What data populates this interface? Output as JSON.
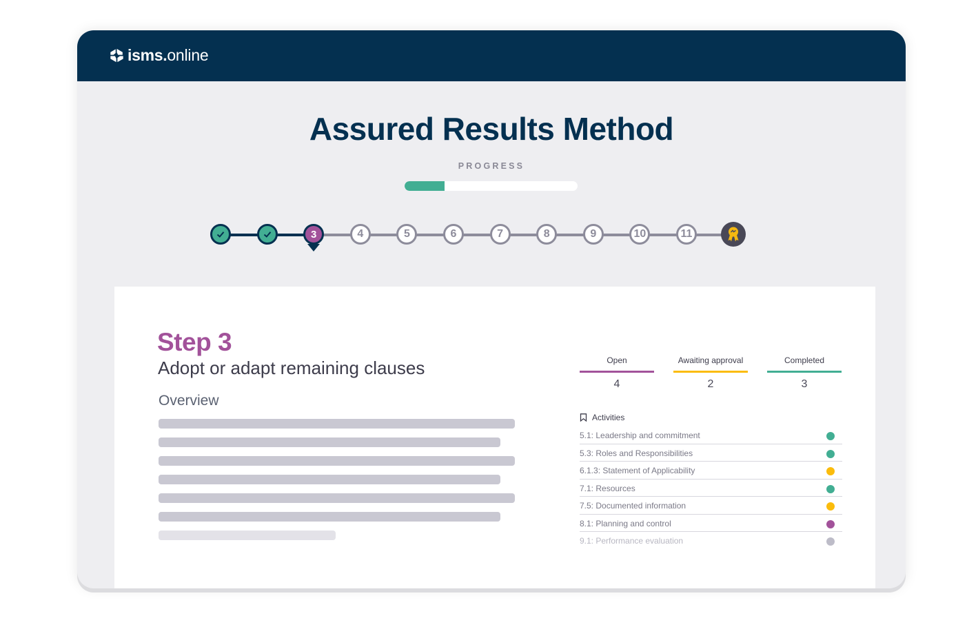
{
  "header": {
    "logo_icon": "isms-logo-icon",
    "brand_bold": "isms.",
    "brand_light": "online"
  },
  "page": {
    "title": "Assured Results Method",
    "progress_label": "PROGRESS",
    "progress_fraction": 0.23
  },
  "stepper": {
    "steps": [
      {
        "label": "✓",
        "state": "done",
        "icon": "check-icon"
      },
      {
        "label": "✓",
        "state": "done",
        "icon": "check-icon"
      },
      {
        "label": "3",
        "state": "current"
      },
      {
        "label": "4",
        "state": "todo"
      },
      {
        "label": "5",
        "state": "todo"
      },
      {
        "label": "6",
        "state": "todo"
      },
      {
        "label": "7",
        "state": "todo"
      },
      {
        "label": "8",
        "state": "todo"
      },
      {
        "label": "9",
        "state": "todo"
      },
      {
        "label": "10",
        "state": "todo"
      },
      {
        "label": "11",
        "state": "todo"
      },
      {
        "label": "",
        "state": "final",
        "icon": "award-rosette-icon"
      }
    ]
  },
  "colors": {
    "navy": "#043050",
    "teal": "#42ae93",
    "purple": "#a2529a",
    "amber": "#fbbc0c",
    "grey": "#bdbcc8",
    "award_gold": "#f5b811"
  },
  "main": {
    "step_heading": "Step 3",
    "step_subtitle": "Adopt or adapt remaining clauses",
    "overview_label": "Overview",
    "stats": [
      {
        "label": "Open",
        "value": "4",
        "color": "#a2529a"
      },
      {
        "label": "Awaiting approval",
        "value": "2",
        "color": "#fbbc0c"
      },
      {
        "label": "Completed",
        "value": "3",
        "color": "#42ae93"
      }
    ],
    "activities_label": "Activities",
    "activities": [
      {
        "label": "5.1: Leadership and commitment",
        "status": "completed",
        "color": "#42ae93"
      },
      {
        "label": "5.3: Roles and Responsibilities",
        "status": "completed",
        "color": "#42ae93"
      },
      {
        "label": "6.1.3: Statement of Applicability",
        "status": "awaiting",
        "color": "#fbbc0c"
      },
      {
        "label": "7.1: Resources",
        "status": "completed",
        "color": "#42ae93"
      },
      {
        "label": "7.5: Documented information",
        "status": "awaiting",
        "color": "#fbbc0c"
      },
      {
        "label": "8.1: Planning and control",
        "status": "open",
        "color": "#a2529a"
      },
      {
        "label": "9.1: Performance evaluation",
        "status": "faded",
        "color": "#bdbcc8"
      }
    ]
  }
}
